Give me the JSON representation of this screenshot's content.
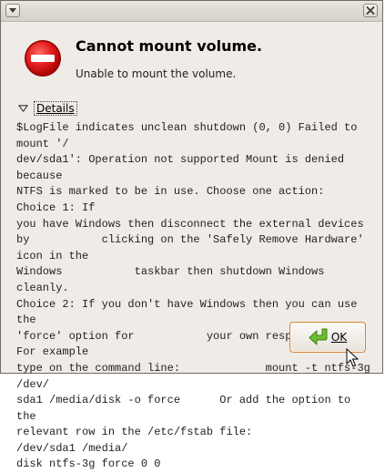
{
  "dialog": {
    "title": "Cannot mount volume.",
    "message": "Unable to mount the volume.",
    "details_label": "Details",
    "details_text": "$LogFile indicates unclean shutdown (0, 0) Failed to mount '/\ndev/sda1': Operation not supported Mount is denied because\nNTFS is marked to be in use. Choose one action:  Choice 1: If\nyou have Windows then disconnect the external devices\nby           clicking on the 'Safely Remove Hardware' icon in the\nWindows           taskbar then shutdown Windows cleanly.\nChoice 2: If you don't have Windows then you can use the\n'force' option for           your own responsibility. For example\ntype on the command line:             mount -t ntfs-3g /dev/\nsda1 /media/disk -o force      Or add the option to the\nrelevant row in the /etc/fstab file:             /dev/sda1 /media/\ndisk ntfs-3g force 0 0",
    "ok_label": "OK"
  },
  "icons": {
    "window_menu": "window-menu-icon",
    "close": "close-icon",
    "error": "error-icon",
    "expander": "expander-triangle-icon",
    "ok": "check-arrow-icon",
    "cursor": "mouse-cursor-icon"
  },
  "colors": {
    "error_red": "#cc0000",
    "focus_orange": "#d6853a",
    "ok_icon_green": "#4e9a06"
  }
}
